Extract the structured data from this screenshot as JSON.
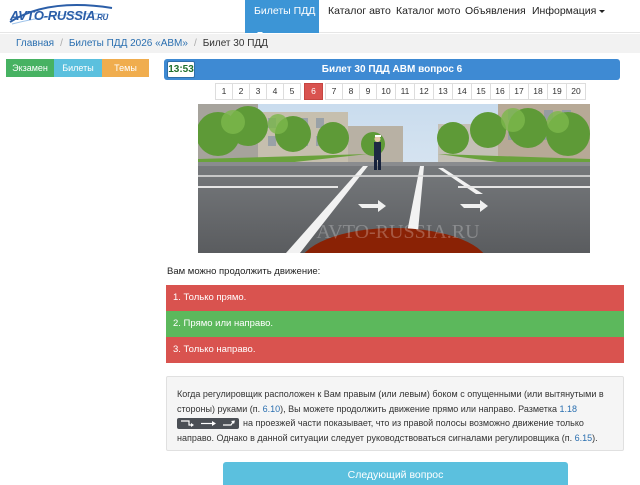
{
  "nav": {
    "logo_text": "AVTO-RUSSIA",
    "logo_suffix": ".RU",
    "items": [
      {
        "label": "Билеты ПДД"
      },
      {
        "label": "Каталог авто"
      },
      {
        "label": "Каталог мото"
      },
      {
        "label": "Объявления"
      },
      {
        "label": "Информация"
      }
    ],
    "accent": "#3c95d6"
  },
  "breadcrumb": [
    "Главная",
    "Билеты ПДД 2026 «ABM»",
    "Билет 30 ПДД"
  ],
  "mode_tabs": [
    "Экзамен",
    "Билеты",
    "Темы"
  ],
  "ticket": {
    "timer": "13:53",
    "title": "Билет 30 ПДД ABM вопрос 6"
  },
  "pagination": {
    "pages": [
      "1",
      "2",
      "3",
      "4",
      "5",
      "6",
      "7",
      "8",
      "9",
      "10",
      "11",
      "12",
      "13",
      "14",
      "15",
      "16",
      "17",
      "18",
      "19",
      "20"
    ],
    "current": "6"
  },
  "scene": {
    "watermark": "AVTO-RUSSIA.RU"
  },
  "question": {
    "text": "Вам можно продолжить движение:",
    "answers": [
      {
        "label": "1. Только прямо.",
        "state": "wrong"
      },
      {
        "label": "2. Прямо или направо.",
        "state": "right"
      },
      {
        "label": "3. Только направо.",
        "state": "wrong"
      }
    ]
  },
  "explanation": {
    "p1": "Когда регулировщик расположен к Вам правым (или левым) боком с опущенными (или вытянутыми в стороны) руками (п.",
    "ref1": "6.10",
    "p2": "), Вы можете продолжить движение прямо или направо. Разметка",
    "ref2": "1.18",
    "p3": "на проезжей части показывает, что из правой полосы возможно движение только направо. Однако в данной ситуации следует руководствоваться сигналами регулировщика (п.",
    "ref3": "6.15",
    "p4": ")."
  },
  "next_button": "Следующий вопрос",
  "colors": {
    "wrong": "#d9534f",
    "right": "#5cb85c",
    "header": "#3e8ad3",
    "tickets_tab": "#5bc0de",
    "topics_tab": "#f0ad4e"
  }
}
